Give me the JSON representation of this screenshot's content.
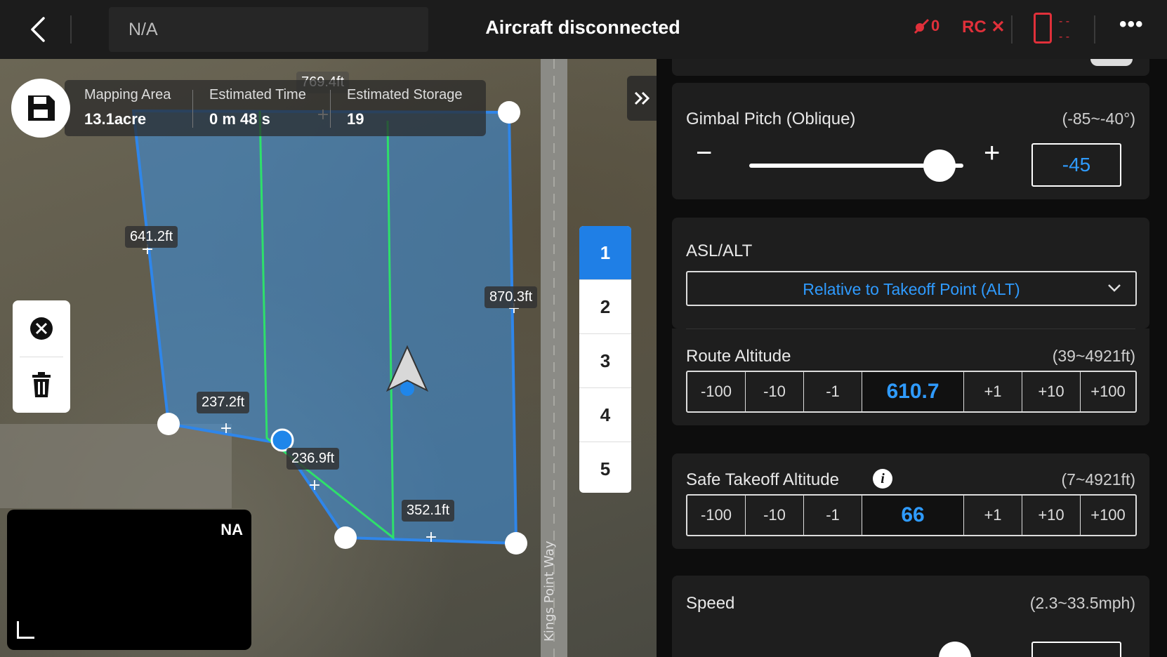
{
  "topbar": {
    "model": "N/A",
    "title": "Aircraft disconnected",
    "signal_count": "0",
    "rc_label": "RC",
    "battery_dashes": "- -"
  },
  "mission": {
    "stats": [
      {
        "label": "Mapping Area",
        "value": "13.1acre"
      },
      {
        "label": "Estimated Time",
        "value": "0 m 48 s"
      },
      {
        "label": "Estimated Storage",
        "value": "19"
      }
    ],
    "segments": [
      "769.4ft",
      "641.2ft",
      "870.3ft",
      "237.2ft",
      "236.9ft",
      "352.1ft"
    ],
    "road_label": "Kings Point Way",
    "camera_label": "NA",
    "list_items": [
      "1",
      "2",
      "3",
      "4",
      "5"
    ],
    "active_item": "1"
  },
  "settings": {
    "gimbal": {
      "label": "Gimbal Pitch (Oblique)",
      "range": "(-85~-40°)",
      "value": "-45",
      "fraction": 0.89
    },
    "asl": {
      "label": "ASL/ALT",
      "selected": "Relative to Takeoff Point (ALT)"
    },
    "route_altitude": {
      "label": "Route Altitude",
      "range": "(39~4921ft)",
      "value": "610.7",
      "steps": [
        "-100",
        "-10",
        "-1",
        "+1",
        "+10",
        "+100"
      ]
    },
    "safe_takeoff": {
      "label": "Safe Takeoff Altitude",
      "range": "(7~4921ft)",
      "value": "66",
      "steps": [
        "-100",
        "-10",
        "-1",
        "+1",
        "+10",
        "+100"
      ]
    },
    "speed": {
      "label": "Speed",
      "range": "(2.3~33.5mph)"
    }
  },
  "colors": {
    "accent": "#2f9bff",
    "active_tab": "#1f7fe6",
    "warning": "#e0303a",
    "route_line": "#2ee06a",
    "area_fill": "#3b8fe0"
  }
}
